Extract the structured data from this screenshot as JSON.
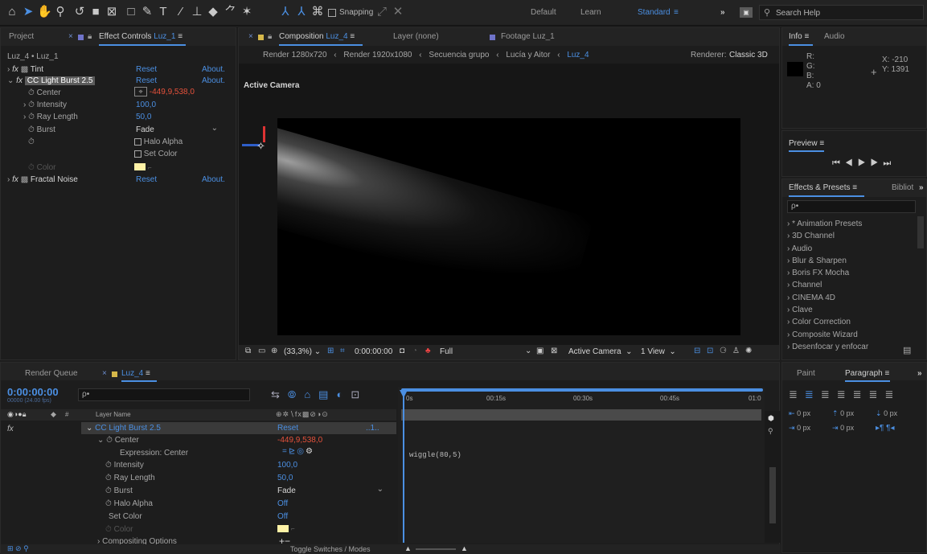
{
  "toolbar": {
    "snapping_label": "Snapping",
    "workspaces": [
      "Default",
      "Learn",
      "Standard"
    ],
    "search_placeholder": "Search Help"
  },
  "effect_controls": {
    "tab_project": "Project",
    "tab_label": "Effect Controls",
    "tab_target": "Luz_1",
    "breadcrumb": "Luz_4 • Luz_1",
    "effects": [
      {
        "name": "Tint",
        "reset": "Reset",
        "about": "About."
      },
      {
        "name": "CC Light Burst 2.5",
        "reset": "Reset",
        "about": "About."
      },
      {
        "name": "Fractal Noise",
        "reset": "Reset",
        "about": "About."
      }
    ],
    "props": {
      "center_label": "Center",
      "center_value": "-449,9,538,0",
      "intensity_label": "Intensity",
      "intensity_value": "100,0",
      "ray_label": "Ray Length",
      "ray_value": "50,0",
      "burst_label": "Burst",
      "burst_value": "Fade",
      "halo_label": "Halo Alpha",
      "setcolor_label": "Set Color",
      "color_label": "Color"
    }
  },
  "composition": {
    "tab_label": "Composition",
    "tab_target": "Luz_4",
    "layer_tab": "Layer (none)",
    "footage_tab": "Footage Luz_1",
    "breadcrumbs": [
      "Render 1280x720",
      "Render 1920x1080",
      "Secuencia grupo",
      "Lucía y Aitor",
      "Luz_4"
    ],
    "renderer_label": "Renderer:",
    "renderer_value": "Classic 3D",
    "view_label": "Active Camera",
    "footer": {
      "zoom": "(33,3%)",
      "timecode": "0:00:00:00",
      "resolution": "Full",
      "camera": "Active Camera",
      "views": "1 View"
    }
  },
  "info": {
    "tab_info": "Info",
    "tab_audio": "Audio",
    "r": "R:",
    "g": "G:",
    "b": "B:",
    "a": "A: 0",
    "x": "X: -210",
    "y": "Y: 1391"
  },
  "preview": {
    "title": "Preview"
  },
  "effects_presets": {
    "tab": "Effects & Presets",
    "tab2": "Bibliot",
    "search_placeholder": "ρ•",
    "items": [
      "* Animation Presets",
      "3D Channel",
      "Audio",
      "Blur & Sharpen",
      "Boris FX Mocha",
      "Channel",
      "CINEMA 4D",
      "Clave",
      "Color Correction",
      "Composite Wizard",
      "Desenfocar y enfocar"
    ]
  },
  "timeline": {
    "tab_render_queue": "Render Queue",
    "tab_comp": "Luz_4",
    "timecode": "0:00:00:00",
    "fps": "00000 (24.00 fps)",
    "search_placeholder": "ρ•",
    "col_hash": "#",
    "col_layer": "Layer Name",
    "layer_name": "CC Light Burst 2.5",
    "reset": "Reset",
    "rows": [
      {
        "label": "Center",
        "value": "-449,9,538,0"
      },
      {
        "label": "Expression: Center",
        "value": ""
      },
      {
        "label": "Intensity",
        "value": "100,0"
      },
      {
        "label": "Ray Length",
        "value": "50,0"
      },
      {
        "label": "Burst",
        "value": "Fade"
      },
      {
        "label": "Halo Alpha",
        "value": "Off"
      },
      {
        "label": "Set Color",
        "value": "Off"
      },
      {
        "label": "Color",
        "value": ""
      },
      {
        "label": "Compositing Options",
        "value": "+−"
      }
    ],
    "ruler": [
      "0s",
      "00:15s",
      "00:30s",
      "00:45s",
      "01:0"
    ],
    "expression": "wiggle(80,5)",
    "toggle_label": "Toggle Switches / Modes"
  },
  "paragraph": {
    "tab_paint": "Paint",
    "tab_paragraph": "Paragraph",
    "values": [
      "0 px",
      "0 px",
      "0 px",
      "0 px",
      "0 px"
    ]
  },
  "colors": {
    "accent": "#4b8fe2",
    "value_red": "#e5513b",
    "swatch": "#fff2a6"
  }
}
